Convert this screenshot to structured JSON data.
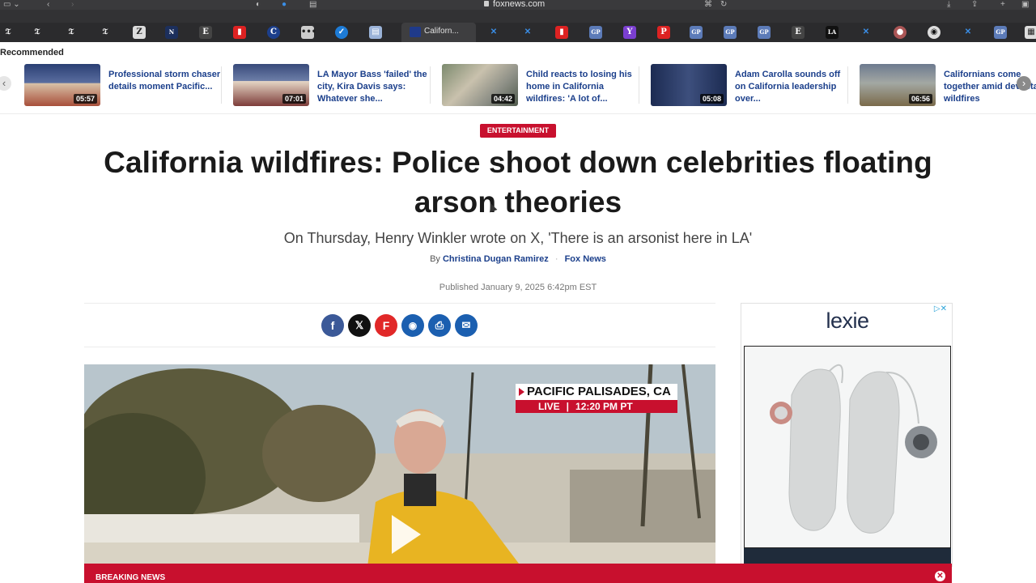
{
  "browser": {
    "url": "foxnews.com",
    "active_tab_label": "Californ..."
  },
  "recommended": {
    "label": "Recommended",
    "items": [
      {
        "title": "Professional storm chaser details moment Pacific...",
        "duration": "05:57"
      },
      {
        "title": "LA Mayor Bass 'failed' the city, Kira Davis says: Whatever she...",
        "duration": "07:01"
      },
      {
        "title": "Child reacts to losing his home in California wildfires: 'A lot of...",
        "duration": "04:42"
      },
      {
        "title": "Adam Carolla sounds off on California leadership over...",
        "duration": "05:08"
      },
      {
        "title": "Californians come together amid devastating wildfires",
        "duration": "06:56"
      }
    ]
  },
  "article": {
    "category": "ENTERTAINMENT",
    "headline": "California wildfires: Police shoot down celebrities floating arson theories",
    "subhead": "On Thursday, Henry Winkler wrote on X, 'There is an arsonist here in LA'",
    "by_prefix": "By",
    "author": "Christina Dugan Ramirez",
    "outlet": "Fox News",
    "published": "Published January 9, 2025 6:42pm EST"
  },
  "share_buttons": [
    {
      "name": "facebook",
      "glyph": "f",
      "color": "#3b5998"
    },
    {
      "name": "x",
      "glyph": "𝕏",
      "color": "#111111"
    },
    {
      "name": "flipboard",
      "glyph": "F",
      "color": "#e12828"
    },
    {
      "name": "comments",
      "glyph": "💬",
      "color": "#1b5fb0"
    },
    {
      "name": "print",
      "glyph": "⎙",
      "color": "#1b5fb0"
    },
    {
      "name": "email",
      "glyph": "✉",
      "color": "#1b5fb0"
    }
  ],
  "video": {
    "location": "PACIFIC PALISADES, CA",
    "live_label": "LIVE",
    "time": "12:20 PM PT"
  },
  "ad": {
    "brand": "lexie"
  },
  "breaking": {
    "label": "BREAKING NEWS"
  }
}
